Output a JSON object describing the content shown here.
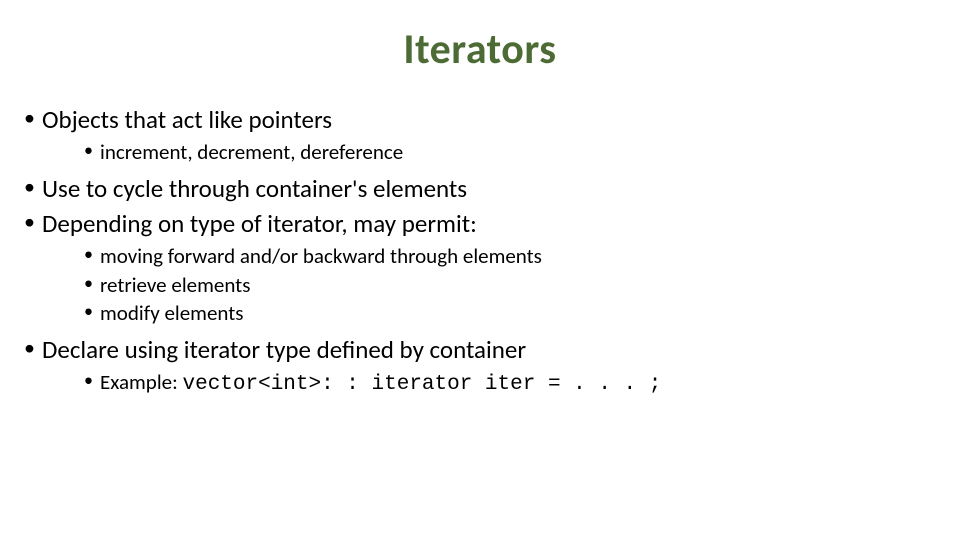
{
  "title": "Iterators",
  "bullets": {
    "b1": "Objects that act like pointers",
    "b1_sub": {
      "s1": "increment, decrement, dereference"
    },
    "b2": "Use to cycle through container's elements",
    "b3": "Depending on type of iterator, may permit:",
    "b3_sub": {
      "s1": "moving forward and/or backward through elements",
      "s2": "retrieve elements",
      "s3": "modify elements"
    },
    "b4": "Declare using iterator type defined by container",
    "b4_sub": {
      "s1_prefix": "Example: ",
      "s1_code": "vector<int>: : iterator iter = . . . ;"
    }
  },
  "colors": {
    "title": "#4d6b34",
    "body": "#000000"
  }
}
